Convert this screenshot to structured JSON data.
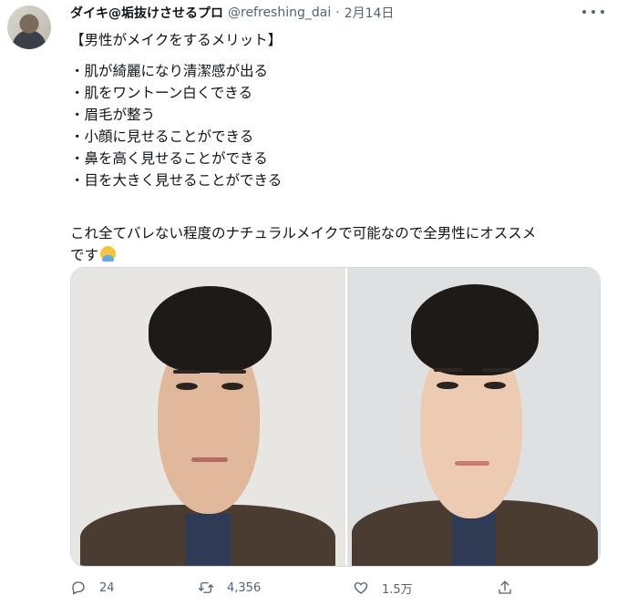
{
  "tweet": {
    "display_name": "ダイキ@垢抜けさせるプロ",
    "handle": "@refreshing_dai",
    "separator": "·",
    "date": "2月14日",
    "text_lines": [
      "【男性がメイクをするメリット】",
      "・肌が綺麗になり清潔感が出る",
      "・肌をワントーン白くできる",
      "・眉毛が整う",
      "・小顔に見せることができる",
      "・鼻を高く見せることができる",
      "・目を大きく見せることができる"
    ],
    "closing_line_1": "これ全てバレない程度のナチュラルメイクで可能なので全男性にオススメ",
    "closing_line_2": "です"
  },
  "actions": {
    "reply_count": "24",
    "retweet_count": "4,356",
    "like_count": "1.5万"
  },
  "icons": {
    "reply": "reply-icon",
    "retweet": "retweet-icon",
    "like": "heart-icon",
    "share": "share-icon",
    "more": "more-icon",
    "emoji": "person-gesturing-ok-emoji"
  },
  "colors": {
    "text": "#0f1419",
    "secondary": "#536471",
    "border": "#cfd9de"
  }
}
